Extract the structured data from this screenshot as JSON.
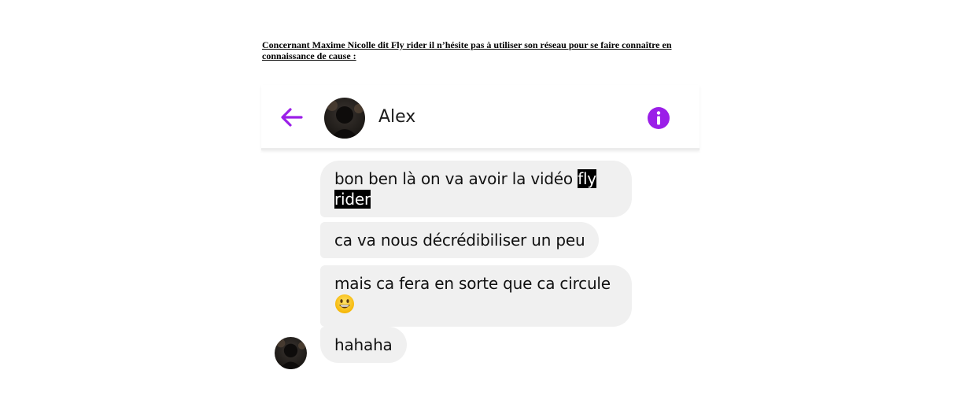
{
  "document": {
    "heading": "Concernant Maxime Nicolle dit Fly rider il n’hésite pas à utiliser son réseau pour se faire connaître en connaissance de cause :"
  },
  "chat": {
    "contact_name": "Alex",
    "accent_color": "#9b1fe8",
    "icons": {
      "back": "arrow-left-icon",
      "info": "info-icon"
    },
    "messages": [
      {
        "text_before": "bon ben là on va avoir la vidéo ",
        "highlighted": "fly",
        "highlighted_2": "rider"
      },
      {
        "text": "ca va nous décrédibiliser un peu"
      },
      {
        "text": "mais ca fera en sorte que ca circule",
        "emoji": "grinning-face-emoji"
      },
      {
        "text": "hahaha"
      }
    ]
  }
}
